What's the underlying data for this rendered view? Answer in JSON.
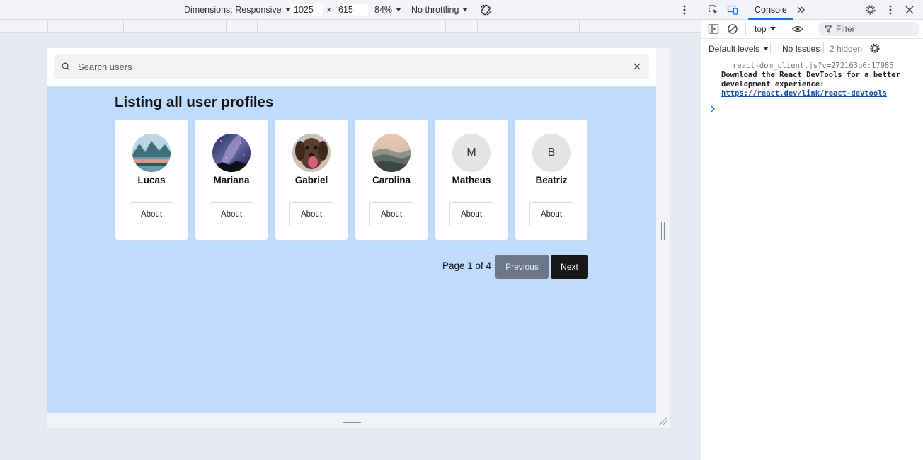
{
  "device_toolbar": {
    "dimensions_label": "Dimensions: Responsive",
    "width": "1025",
    "times": "×",
    "height": "615",
    "zoom": "84%",
    "throttling": "No throttling"
  },
  "page": {
    "search": {
      "placeholder": "Search users"
    },
    "title": "Listing all user profiles",
    "users": [
      {
        "name": "Lucas",
        "avatar": "lake-mountains-photo",
        "about": "About"
      },
      {
        "name": "Mariana",
        "avatar": "milky-way-night-photo",
        "about": "About"
      },
      {
        "name": "Gabriel",
        "avatar": "dog-photo",
        "about": "About"
      },
      {
        "name": "Carolina",
        "avatar": "misty-hills-photo",
        "about": "About"
      },
      {
        "name": "Matheus",
        "initial": "M",
        "about": "About"
      },
      {
        "name": "Beatriz",
        "initial": "B",
        "about": "About"
      }
    ],
    "pagination": {
      "info": "Page 1 of 4",
      "previous": "Previous",
      "next": "Next"
    }
  },
  "devtools": {
    "tabs": {
      "console": "Console"
    },
    "context": "top",
    "filter_placeholder": "Filter",
    "levels": "Default levels",
    "issues": "No Issues",
    "hidden": "2 hidden",
    "message": {
      "source": "react-dom_client.js?v=272163b6:17985",
      "text": "Download the React DevTools for a better development experience:",
      "link": "https://react.dev/link/react-devtools"
    }
  },
  "colors": {
    "page_background": "#bfdbfe",
    "next_button": "#18181b",
    "previous_button": "#6b7788",
    "devtools_accent": "#1a73e8"
  }
}
